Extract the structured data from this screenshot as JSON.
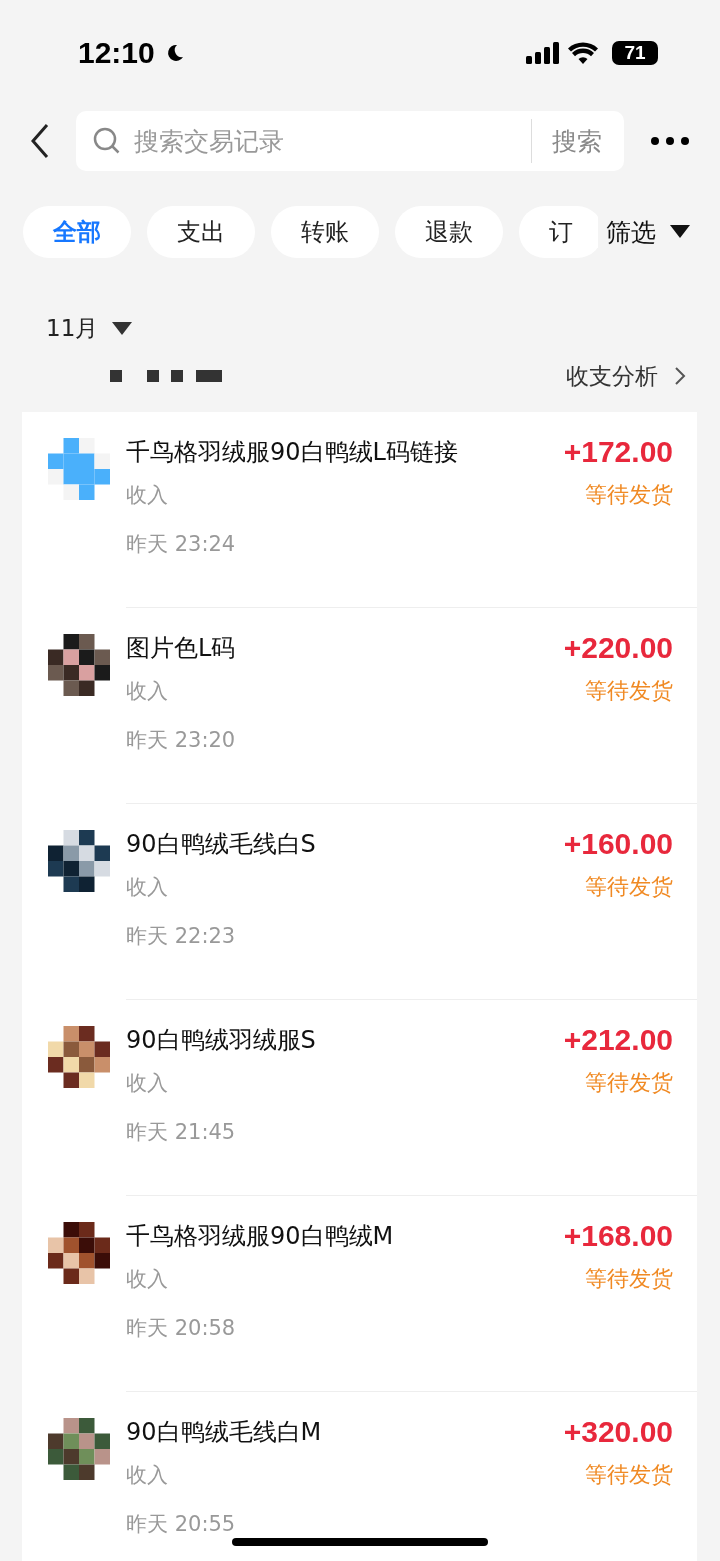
{
  "status_bar": {
    "time": "12:10",
    "battery": "71"
  },
  "search": {
    "placeholder": "搜索交易记录",
    "button": "搜索"
  },
  "chips": [
    {
      "label": "全部",
      "selected": true
    },
    {
      "label": "支出",
      "selected": false
    },
    {
      "label": "转账",
      "selected": false
    },
    {
      "label": "退款",
      "selected": false
    },
    {
      "label": "订",
      "selected": false
    }
  ],
  "filter": "筛选",
  "month": "11月",
  "analysis_link": "收支分析",
  "transactions": [
    {
      "title": "千鸟格羽绒服90白鸭绒L码链接",
      "type": "收入",
      "time": "昨天 23:24",
      "amount": "+172.00",
      "status": "等待发货"
    },
    {
      "title": "图片色L码",
      "type": "收入",
      "time": "昨天 23:20",
      "amount": "+220.00",
      "status": "等待发货"
    },
    {
      "title": "90白鸭绒毛线白S",
      "type": "收入",
      "time": "昨天 22:23",
      "amount": "+160.00",
      "status": "等待发货"
    },
    {
      "title": "90白鸭绒羽绒服S",
      "type": "收入",
      "time": "昨天 21:45",
      "amount": "+212.00",
      "status": "等待发货"
    },
    {
      "title": "千鸟格羽绒服90白鸭绒M",
      "type": "收入",
      "time": "昨天 20:58",
      "amount": "+168.00",
      "status": "等待发货"
    },
    {
      "title": "90白鸭绒毛线白M",
      "type": "收入",
      "time": "昨天 20:55",
      "amount": "+320.00",
      "status": "等待发货"
    }
  ]
}
